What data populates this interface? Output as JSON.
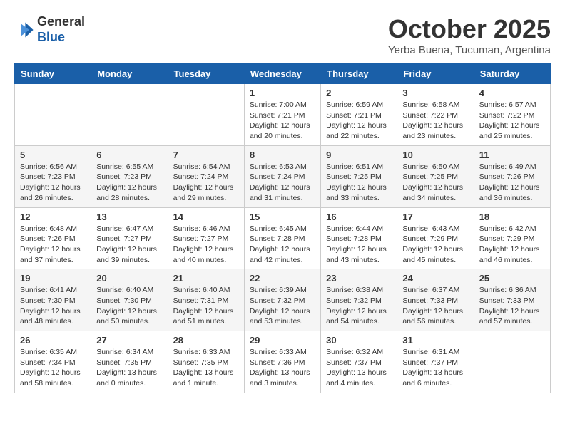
{
  "header": {
    "logo_line1": "General",
    "logo_line2": "Blue",
    "month": "October 2025",
    "location": "Yerba Buena, Tucuman, Argentina"
  },
  "weekdays": [
    "Sunday",
    "Monday",
    "Tuesday",
    "Wednesday",
    "Thursday",
    "Friday",
    "Saturday"
  ],
  "weeks": [
    [
      {
        "day": "",
        "info": ""
      },
      {
        "day": "",
        "info": ""
      },
      {
        "day": "",
        "info": ""
      },
      {
        "day": "1",
        "info": "Sunrise: 7:00 AM\nSunset: 7:21 PM\nDaylight: 12 hours\nand 20 minutes."
      },
      {
        "day": "2",
        "info": "Sunrise: 6:59 AM\nSunset: 7:21 PM\nDaylight: 12 hours\nand 22 minutes."
      },
      {
        "day": "3",
        "info": "Sunrise: 6:58 AM\nSunset: 7:22 PM\nDaylight: 12 hours\nand 23 minutes."
      },
      {
        "day": "4",
        "info": "Sunrise: 6:57 AM\nSunset: 7:22 PM\nDaylight: 12 hours\nand 25 minutes."
      }
    ],
    [
      {
        "day": "5",
        "info": "Sunrise: 6:56 AM\nSunset: 7:23 PM\nDaylight: 12 hours\nand 26 minutes."
      },
      {
        "day": "6",
        "info": "Sunrise: 6:55 AM\nSunset: 7:23 PM\nDaylight: 12 hours\nand 28 minutes."
      },
      {
        "day": "7",
        "info": "Sunrise: 6:54 AM\nSunset: 7:24 PM\nDaylight: 12 hours\nand 29 minutes."
      },
      {
        "day": "8",
        "info": "Sunrise: 6:53 AM\nSunset: 7:24 PM\nDaylight: 12 hours\nand 31 minutes."
      },
      {
        "day": "9",
        "info": "Sunrise: 6:51 AM\nSunset: 7:25 PM\nDaylight: 12 hours\nand 33 minutes."
      },
      {
        "day": "10",
        "info": "Sunrise: 6:50 AM\nSunset: 7:25 PM\nDaylight: 12 hours\nand 34 minutes."
      },
      {
        "day": "11",
        "info": "Sunrise: 6:49 AM\nSunset: 7:26 PM\nDaylight: 12 hours\nand 36 minutes."
      }
    ],
    [
      {
        "day": "12",
        "info": "Sunrise: 6:48 AM\nSunset: 7:26 PM\nDaylight: 12 hours\nand 37 minutes."
      },
      {
        "day": "13",
        "info": "Sunrise: 6:47 AM\nSunset: 7:27 PM\nDaylight: 12 hours\nand 39 minutes."
      },
      {
        "day": "14",
        "info": "Sunrise: 6:46 AM\nSunset: 7:27 PM\nDaylight: 12 hours\nand 40 minutes."
      },
      {
        "day": "15",
        "info": "Sunrise: 6:45 AM\nSunset: 7:28 PM\nDaylight: 12 hours\nand 42 minutes."
      },
      {
        "day": "16",
        "info": "Sunrise: 6:44 AM\nSunset: 7:28 PM\nDaylight: 12 hours\nand 43 minutes."
      },
      {
        "day": "17",
        "info": "Sunrise: 6:43 AM\nSunset: 7:29 PM\nDaylight: 12 hours\nand 45 minutes."
      },
      {
        "day": "18",
        "info": "Sunrise: 6:42 AM\nSunset: 7:29 PM\nDaylight: 12 hours\nand 46 minutes."
      }
    ],
    [
      {
        "day": "19",
        "info": "Sunrise: 6:41 AM\nSunset: 7:30 PM\nDaylight: 12 hours\nand 48 minutes."
      },
      {
        "day": "20",
        "info": "Sunrise: 6:40 AM\nSunset: 7:30 PM\nDaylight: 12 hours\nand 50 minutes."
      },
      {
        "day": "21",
        "info": "Sunrise: 6:40 AM\nSunset: 7:31 PM\nDaylight: 12 hours\nand 51 minutes."
      },
      {
        "day": "22",
        "info": "Sunrise: 6:39 AM\nSunset: 7:32 PM\nDaylight: 12 hours\nand 53 minutes."
      },
      {
        "day": "23",
        "info": "Sunrise: 6:38 AM\nSunset: 7:32 PM\nDaylight: 12 hours\nand 54 minutes."
      },
      {
        "day": "24",
        "info": "Sunrise: 6:37 AM\nSunset: 7:33 PM\nDaylight: 12 hours\nand 56 minutes."
      },
      {
        "day": "25",
        "info": "Sunrise: 6:36 AM\nSunset: 7:33 PM\nDaylight: 12 hours\nand 57 minutes."
      }
    ],
    [
      {
        "day": "26",
        "info": "Sunrise: 6:35 AM\nSunset: 7:34 PM\nDaylight: 12 hours\nand 58 minutes."
      },
      {
        "day": "27",
        "info": "Sunrise: 6:34 AM\nSunset: 7:35 PM\nDaylight: 13 hours\nand 0 minutes."
      },
      {
        "day": "28",
        "info": "Sunrise: 6:33 AM\nSunset: 7:35 PM\nDaylight: 13 hours\nand 1 minute."
      },
      {
        "day": "29",
        "info": "Sunrise: 6:33 AM\nSunset: 7:36 PM\nDaylight: 13 hours\nand 3 minutes."
      },
      {
        "day": "30",
        "info": "Sunrise: 6:32 AM\nSunset: 7:37 PM\nDaylight: 13 hours\nand 4 minutes."
      },
      {
        "day": "31",
        "info": "Sunrise: 6:31 AM\nSunset: 7:37 PM\nDaylight: 13 hours\nand 6 minutes."
      },
      {
        "day": "",
        "info": ""
      }
    ]
  ]
}
